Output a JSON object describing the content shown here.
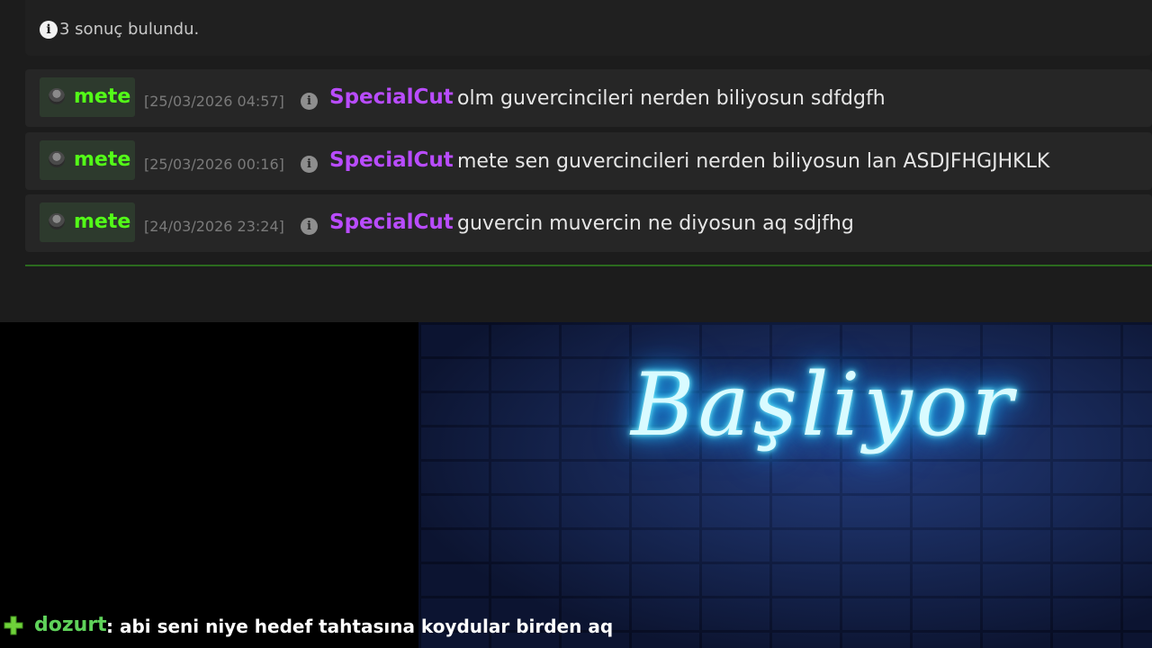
{
  "search_results": {
    "count_text": "3 sonuç bulundu.",
    "info_icon": "info-icon"
  },
  "messages": [
    {
      "user": "mete",
      "timestamp": "[25/03/2026 04:57]",
      "moderator": "SpecialCut",
      "text": "olm guvercincileri nerden biliyosun sdfdgfh"
    },
    {
      "user": "mete",
      "timestamp": "[25/03/2026 00:16]",
      "moderator": "SpecialCut",
      "text": "mete sen guvercincileri nerden biliyosun lan ASDJFHGJHKLK"
    },
    {
      "user": "mete",
      "timestamp": "[24/03/2026 23:24]",
      "moderator": "SpecialCut",
      "text": "guvercin muvercin ne diyosun aq sdjfhg"
    }
  ],
  "stream_overlay": {
    "title": "Başliyor"
  },
  "chat": {
    "user": "dozurt",
    "message": ": abi seni niye hedef tahtasına koydular birden aq",
    "badge_icon": "plus-badge-icon"
  },
  "colors": {
    "username_green": "#53fc18",
    "moderator_purple": "#b94cff",
    "neon_blue": "#2fd6ff",
    "divider_green": "#2b6a1e"
  }
}
